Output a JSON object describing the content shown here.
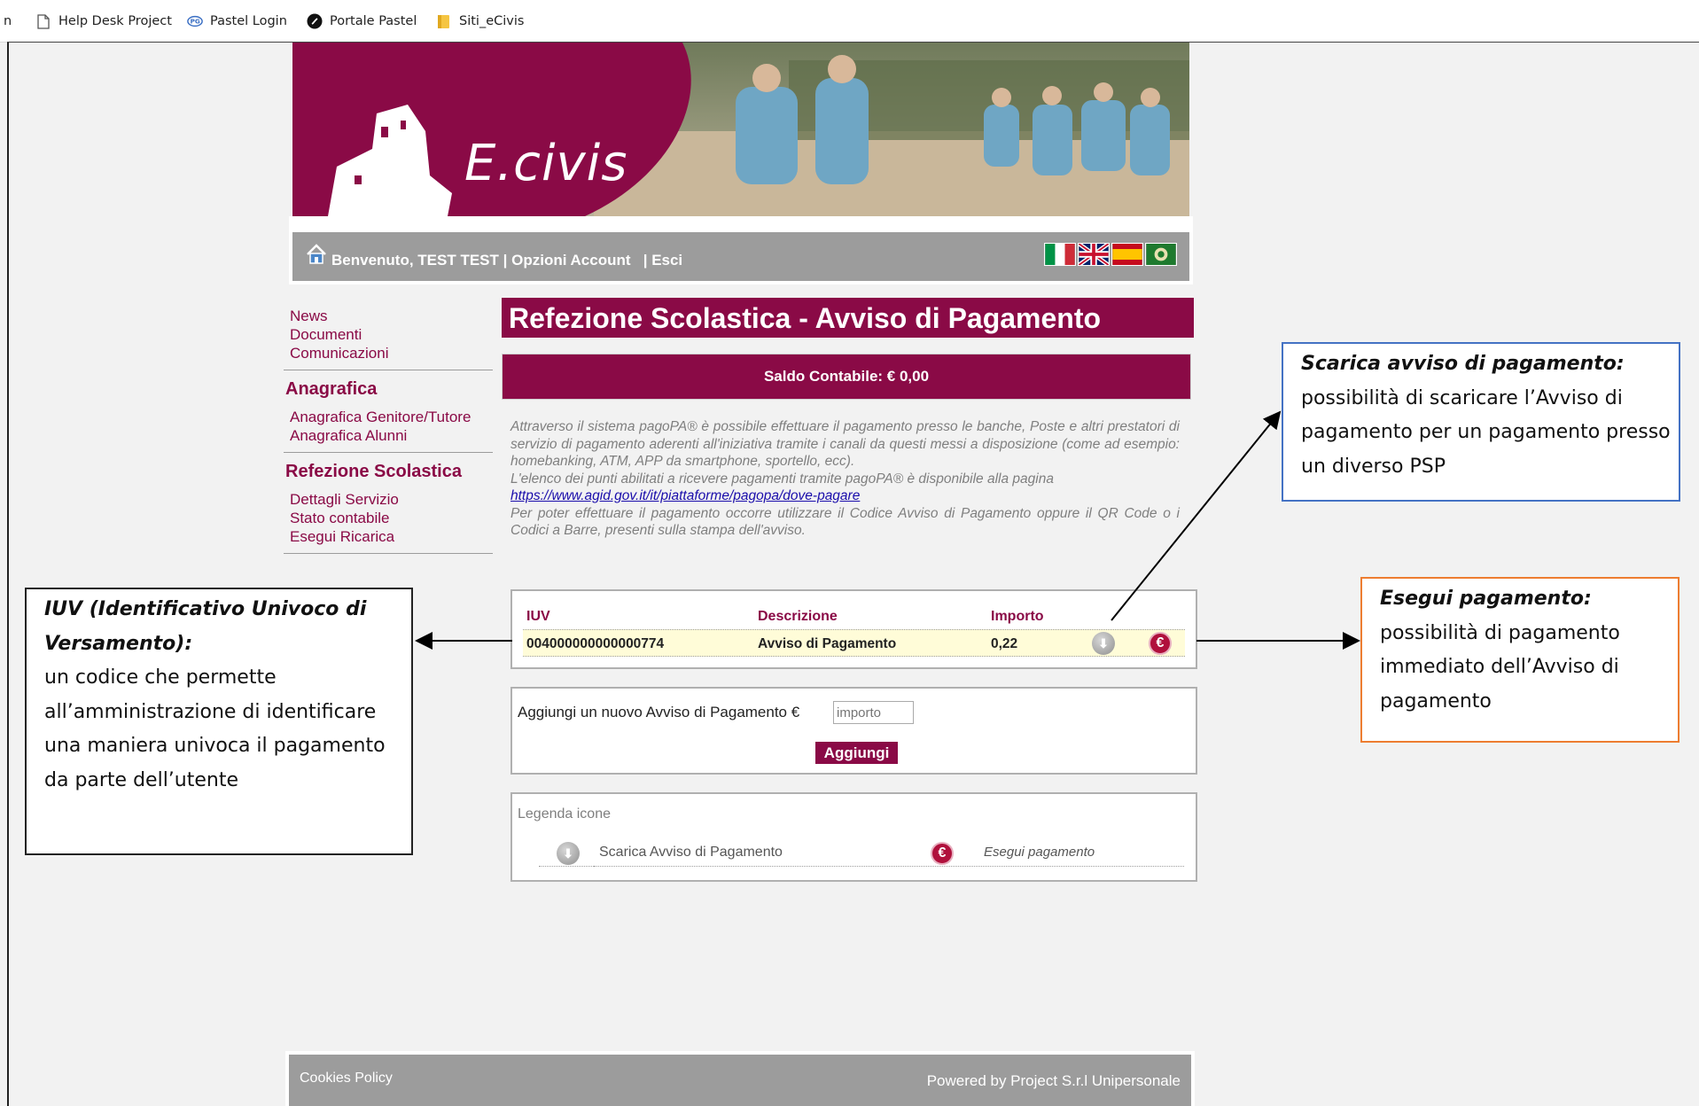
{
  "bookmarks": [
    {
      "label": "n",
      "icon": "none"
    },
    {
      "label": "Help Desk Project",
      "icon": "page-icon"
    },
    {
      "label": "Pastel Login",
      "icon": "pastel-icon"
    },
    {
      "label": "Portale Pastel",
      "icon": "portale-icon"
    },
    {
      "label": "Siti_eCivis",
      "icon": "folder-icon"
    }
  ],
  "banner": {
    "logo_text": "E.civis"
  },
  "navbar": {
    "welcome": "Benvenuto, TEST TEST",
    "account": "Opzioni Account",
    "logout": "Esci",
    "flags": [
      "italian-flag",
      "uk-flag",
      "spanish-flag",
      "regional-flag"
    ]
  },
  "menu": {
    "top_links": [
      "News",
      "Documenti",
      "Comunicazioni"
    ],
    "anagrafica_title": "Anagrafica",
    "anagrafica_links": [
      "Anagrafica Genitore/Tutore",
      "Anagrafica Alunni"
    ],
    "refezione_title": "Refezione Scolastica",
    "refezione_links": [
      "Dettagli Servizio",
      "Stato contabile",
      "Esegui Ricarica"
    ]
  },
  "main": {
    "title": "Refezione Scolastica - Avviso di Pagamento",
    "saldo": "Saldo Contabile: € 0,00",
    "info_1": "Attraverso il sistema pagoPA® è possibile effettuare il pagamento presso le banche, Poste e altri prestatori di servizio di pagamento aderenti all'iniziativa tramite i canali da questi messi a disposizione (come ad esempio: homebanking, ATM, APP da smartphone, sportello, ecc).",
    "info_2": "L'elenco dei punti abilitati a ricevere pagamenti tramite pagoPA® è disponibile alla pagina",
    "info_link": "https://www.agid.gov.it/it/piattaforme/pagopa/dove-pagare",
    "info_3": "Per poter effettuare il pagamento occorre utilizzare il Codice Avviso di Pagamento oppure il QR Code o i Codici a Barre, presenti sulla stampa dell'avviso."
  },
  "table": {
    "headers": {
      "iuv": "IUV",
      "descrizione": "Descrizione",
      "importo": "Importo"
    },
    "rows": [
      {
        "iuv": "004000000000000774",
        "descrizione": "Avviso di Pagamento",
        "importo": "0,22"
      }
    ]
  },
  "add": {
    "label": "Aggiungi un nuovo Avviso di Pagamento €",
    "placeholder": "importo",
    "button": "Aggiungi"
  },
  "legend": {
    "title": "Legenda icone",
    "download_label": "Scarica Avviso di Pagamento",
    "pay_label": "Esegui pagamento"
  },
  "footer": {
    "cookies": "Cookies Policy",
    "powered": "Powered by Project S.r.l Unipersonale"
  },
  "callouts": {
    "iuv_head": "IUV (Identificativo Univoco di Versamento):",
    "iuv_body": "un codice che permette all’amministrazione di identificare una maniera univoca il pagamento da parte dell’utente",
    "scarica_head": "Scarica avviso di pagamento:",
    "scarica_body": "possibilità di scaricare l’Avviso di pagamento per un pagamento presso un diverso PSP",
    "esegui_head": "Esegui pagamento:",
    "esegui_body": "possibilità di pagamento immediato dell’Avviso di pagamento"
  },
  "colors": {
    "brand": "#8a0a46",
    "navbar": "#9c9c9c",
    "row_highlight": "#fffcd8",
    "scarica_border": "#4472c4",
    "esegui_border": "#ed7d31"
  }
}
